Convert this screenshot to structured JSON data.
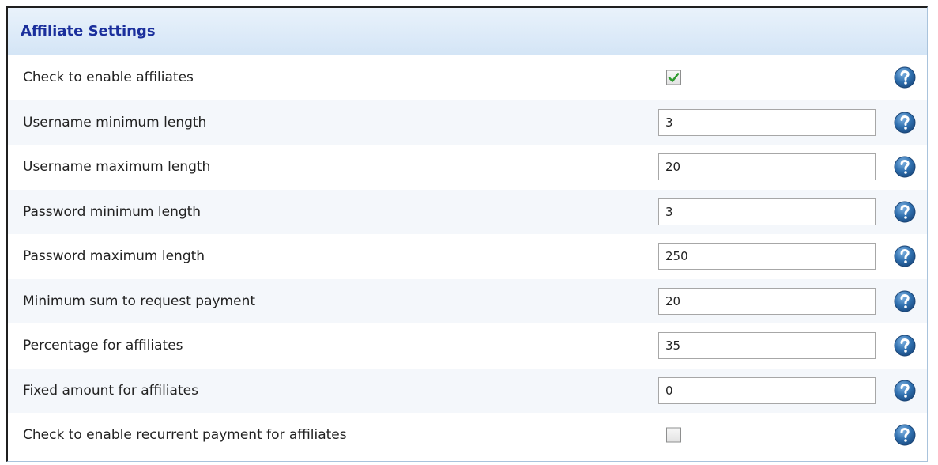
{
  "panel": {
    "title": "Affiliate Settings"
  },
  "rows": [
    {
      "label": "Check to enable affiliates",
      "type": "checkbox",
      "checked": true
    },
    {
      "label": "Username minimum length",
      "type": "text",
      "value": "3"
    },
    {
      "label": "Username maximum length",
      "type": "text",
      "value": "20"
    },
    {
      "label": "Password minimum length",
      "type": "text",
      "value": "3"
    },
    {
      "label": "Password maximum length",
      "type": "text",
      "value": "250"
    },
    {
      "label": "Minimum sum to request payment",
      "type": "text",
      "value": "20"
    },
    {
      "label": "Percentage for affiliates",
      "type": "text",
      "value": "35"
    },
    {
      "label": "Fixed amount for affiliates",
      "type": "text",
      "value": "0"
    },
    {
      "label": "Check to enable recurrent payment for affiliates",
      "type": "checkbox",
      "checked": false
    }
  ],
  "icons": {
    "help": "help-question-icon",
    "check": "checkmark-icon"
  },
  "colors": {
    "title": "#1b2f9c",
    "header_bg": "#dbe9f7",
    "help_icon": "#2a6aa6",
    "checkmark": "#2e9a2e"
  }
}
